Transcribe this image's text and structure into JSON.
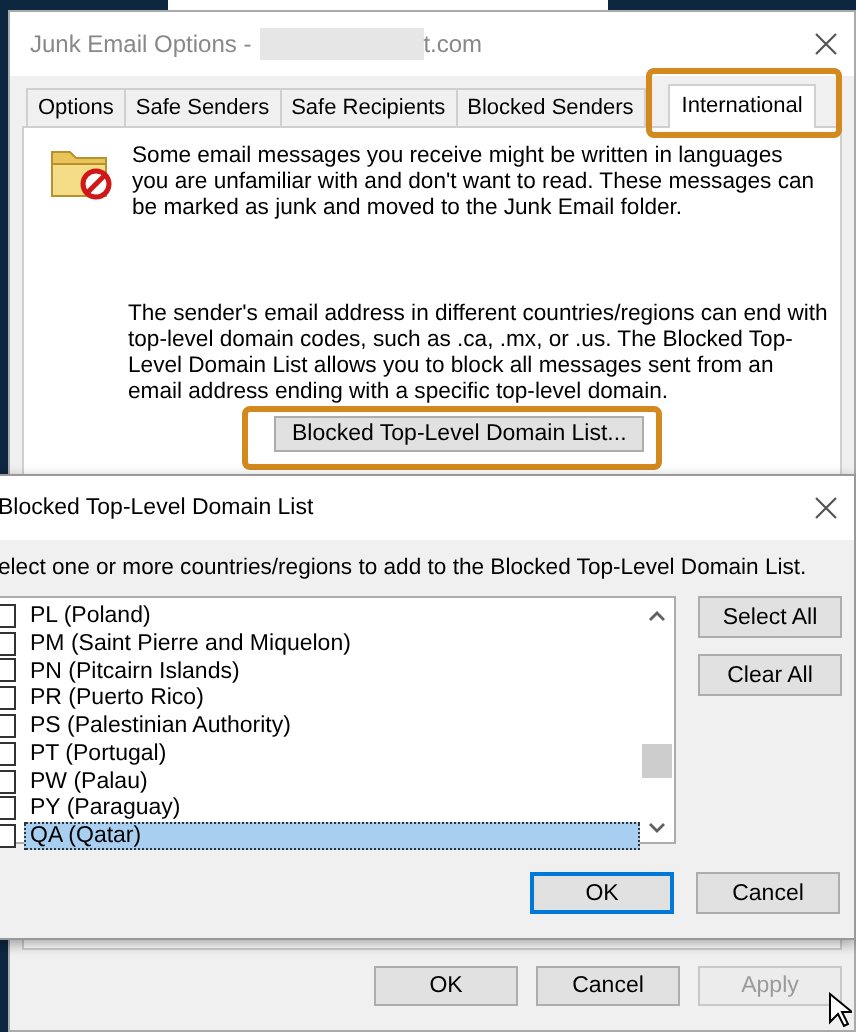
{
  "main_window": {
    "title": "Junk Email Options -",
    "title_end": "t.com",
    "tabs": [
      {
        "label": "Options",
        "selected": false
      },
      {
        "label": "Safe Senders",
        "selected": false
      },
      {
        "label": "Safe Recipients",
        "selected": false
      },
      {
        "label": "Blocked Senders",
        "selected": false
      },
      {
        "label": "International",
        "selected": true
      }
    ],
    "intro": "Some email messages you receive might be written in languages you are unfamiliar with and don't want to read. These messages can be marked as junk and moved to the Junk Email folder.",
    "domain_text": "The sender's email address in different countries/regions can end with top-level domain codes, such as .ca, .mx, or .us. The Blocked Top-Level Domain List allows you to block all messages sent from an email address ending with a specific top-level domain.",
    "domain_button": "Blocked Top-Level Domain List...",
    "buttons": [
      {
        "label": "OK",
        "disabled": false
      },
      {
        "label": "Cancel",
        "disabled": false
      },
      {
        "label": "Apply",
        "disabled": true
      }
    ]
  },
  "domain_dialog": {
    "title": "Blocked Top-Level Domain List",
    "instruction": "elect one or more countries/regions to add to the Blocked Top-Level Domain List.",
    "items": [
      {
        "label": "PL (Poland)",
        "checked": false,
        "selected": false
      },
      {
        "label": "PM (Saint Pierre and Miquelon)",
        "checked": false,
        "selected": false
      },
      {
        "label": "PN (Pitcairn Islands)",
        "checked": false,
        "selected": false
      },
      {
        "label": "PR (Puerto Rico)",
        "checked": false,
        "selected": false
      },
      {
        "label": "PS (Palestinian Authority)",
        "checked": false,
        "selected": false
      },
      {
        "label": "PT (Portugal)",
        "checked": false,
        "selected": false
      },
      {
        "label": "PW (Palau)",
        "checked": false,
        "selected": false
      },
      {
        "label": "PY (Paraguay)",
        "checked": false,
        "selected": false
      },
      {
        "label": "QA (Qatar)",
        "checked": false,
        "selected": true
      }
    ],
    "side_buttons": [
      "Select All",
      "Clear All"
    ],
    "buttons": [
      {
        "label": "OK",
        "focused": true
      },
      {
        "label": "Cancel",
        "focused": false
      }
    ]
  }
}
